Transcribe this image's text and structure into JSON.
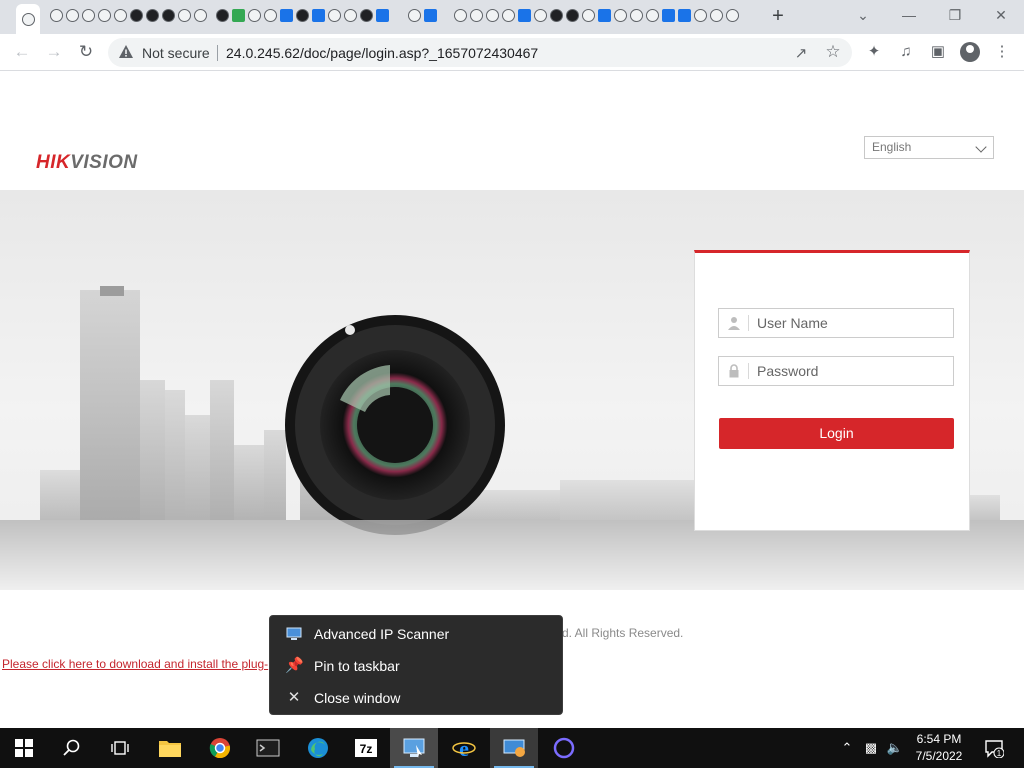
{
  "browser": {
    "tabs_count_note": "",
    "new_tab_label": "+",
    "security_label": "Not secure",
    "url": "24.0.245.62/doc/page/login.asp?_1657072430467"
  },
  "page": {
    "logo_hik": "HIK",
    "logo_vision": "VISION",
    "language": "English",
    "username_placeholder": "User Name",
    "password_placeholder": "Password",
    "login_label": "Login",
    "copyright_tail": "d. All Rights Reserved.",
    "plugin_link": "Please click here to download and install the plug-"
  },
  "jumplist": {
    "items": [
      {
        "label": "Advanced IP Scanner",
        "icon": "network-scanner-icon"
      },
      {
        "label": "Pin to taskbar",
        "icon": "pin-icon"
      },
      {
        "label": "Close window",
        "icon": "close-icon"
      }
    ]
  },
  "taskbar": {
    "time": "6:54 PM",
    "date": "7/5/2022",
    "notification_count": "1"
  },
  "colors": {
    "brand_red": "#d6262a",
    "taskbar": "#101010",
    "menu_bg": "#2b2b2b"
  }
}
